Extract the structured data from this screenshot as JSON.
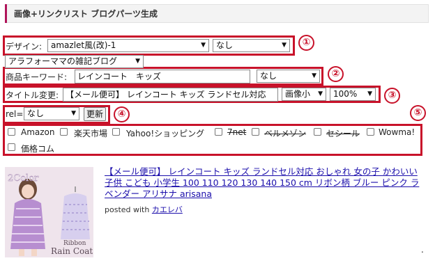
{
  "header": {
    "title": "画像+リンクリスト ブログパーツ生成"
  },
  "row1": {
    "label": "デザイン:",
    "design_select": "amazlet風(改)-1",
    "second_select": "なし",
    "blog_select": "アラフォーママの雑記ブログ"
  },
  "row2": {
    "label": "商品キーワード:",
    "keyword_value": "レインコート　キッズ",
    "select": "なし"
  },
  "row3": {
    "label": "タイトル変更:",
    "title_value": "【メール便可】 レインコート キッズ ランドセル対応",
    "image_size_select": "画像小",
    "percent_select": "100%"
  },
  "row4": {
    "label": "rel=",
    "rel_select": "なし",
    "update_button": "更新"
  },
  "shops": [
    {
      "label": "Amazon",
      "checked": false,
      "struck": false
    },
    {
      "label": "楽天市場",
      "checked": false,
      "struck": false
    },
    {
      "label": "Yahoo!ショッピング",
      "checked": false,
      "struck": false
    },
    {
      "label": "7net",
      "checked": false,
      "struck": true
    },
    {
      "label": "ベルメゾン",
      "checked": false,
      "struck": true
    },
    {
      "label": "セシール",
      "checked": false,
      "struck": true
    },
    {
      "label": "Wowma!",
      "checked": false,
      "struck": false
    },
    {
      "label": "価格コム",
      "checked": false,
      "struck": false
    }
  ],
  "markers": [
    "①",
    "②",
    "③",
    "④",
    "⑤"
  ],
  "product": {
    "link_text": "【メール便可】 レインコート キッズ ランドセル対応 おしゃれ 女の子 かわいい 子供 こども 小学生 100 110 120 130 140 150 cm リボン柄 ブルー ピンク ラベンダー アリサナ arisana",
    "posted_with": "posted with",
    "posted_link": "カエレバ",
    "image_text": {
      "top": "2Color",
      "bottom1": "Ribbon",
      "bottom2": "Rain Coat"
    },
    "dot": "."
  },
  "colors": {
    "accent_red": "#c8122a",
    "link_blue": "#1a0dab",
    "header_bar": "#b0145a"
  }
}
